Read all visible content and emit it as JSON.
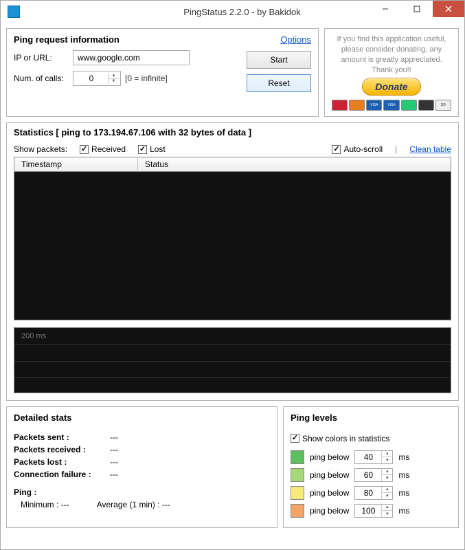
{
  "window": {
    "title": "PingStatus 2.2.0 - by Bakidok"
  },
  "request": {
    "header": "Ping request information",
    "options_link": "Options",
    "ip_label": "IP or URL:",
    "ip_value": "www.google.com",
    "calls_label": "Num. of calls:",
    "calls_value": "0",
    "calls_hint": "[0 = infinite]",
    "start_btn": "Start",
    "reset_btn": "Reset"
  },
  "donate": {
    "text": "If you find this application useful, please consider donating, any amount is greatly appreciated. Thank you!!",
    "button": "Donate"
  },
  "statistics": {
    "title": "Statistics   [ ping to 173.194.67.106 with 32 bytes of data ]",
    "show_packets_label": "Show packets:",
    "received_label": "Received",
    "lost_label": "Lost",
    "autoscroll_label": "Auto-scroll",
    "clean_link": "Clean table",
    "col_timestamp": "Timestamp",
    "col_status": "Status",
    "graph_label": "200 ms"
  },
  "detailed": {
    "title": "Detailed stats",
    "packets_sent_label": "Packets sent :",
    "packets_sent_value": "---",
    "packets_received_label": "Packets received :",
    "packets_received_value": "---",
    "packets_lost_label": "Packets lost :",
    "packets_lost_value": "---",
    "connection_failure_label": "Connection failure :",
    "connection_failure_value": "---",
    "ping_label": "Ping :",
    "minimum_label": "Minimum :",
    "minimum_value": "---",
    "average_label": "Average (1 min) :",
    "average_value": "---"
  },
  "levels": {
    "title": "Ping levels",
    "show_colors_label": "Show colors in statistics",
    "rows": [
      {
        "color": "#5fbf5f",
        "label": "ping below",
        "value": "40",
        "unit": "ms"
      },
      {
        "color": "#a6d87a",
        "label": "ping below",
        "value": "60",
        "unit": "ms"
      },
      {
        "color": "#f5ea7a",
        "label": "ping below",
        "value": "80",
        "unit": "ms"
      },
      {
        "color": "#f2a567",
        "label": "ping below",
        "value": "100",
        "unit": "ms"
      }
    ]
  }
}
